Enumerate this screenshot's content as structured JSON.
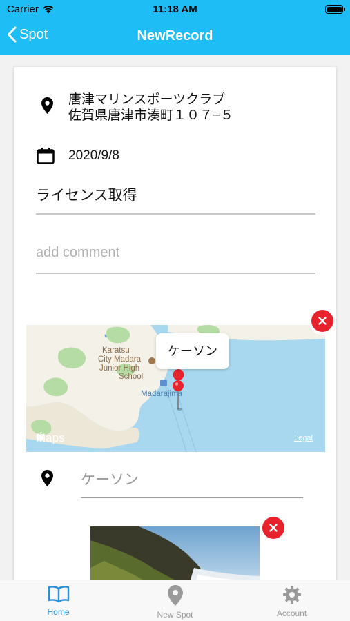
{
  "status_bar": {
    "carrier": "Carrier",
    "time": "11:18 AM"
  },
  "navbar": {
    "back_label": "Spot",
    "title": "NewRecord"
  },
  "record": {
    "place_name": "唐津マリンスポーツクラブ",
    "place_address": "佐賀県唐津市湊町１０７−５",
    "date": "2020/9/8",
    "title": "ライセンス取得",
    "comment_placeholder": "add comment"
  },
  "map": {
    "callout": "ケーソン",
    "labels": {
      "school_1": "Karatsu",
      "school_2": "City Madara",
      "school_3": "Junior High",
      "school_4": "School",
      "island": "Madarajima"
    },
    "attribution": "Maps",
    "legal": "Legal"
  },
  "location_field": {
    "value": "ケーソン"
  },
  "tabs": [
    {
      "label": "Home",
      "icon": "book-icon",
      "active": true
    },
    {
      "label": "New Spot",
      "icon": "map-pin-icon",
      "active": false
    },
    {
      "label": "Account",
      "icon": "gear-icon",
      "active": false
    }
  ],
  "colors": {
    "accent": "#1fbdf5",
    "delete": "#e7222c",
    "tab_active": "#2a8fd9"
  }
}
